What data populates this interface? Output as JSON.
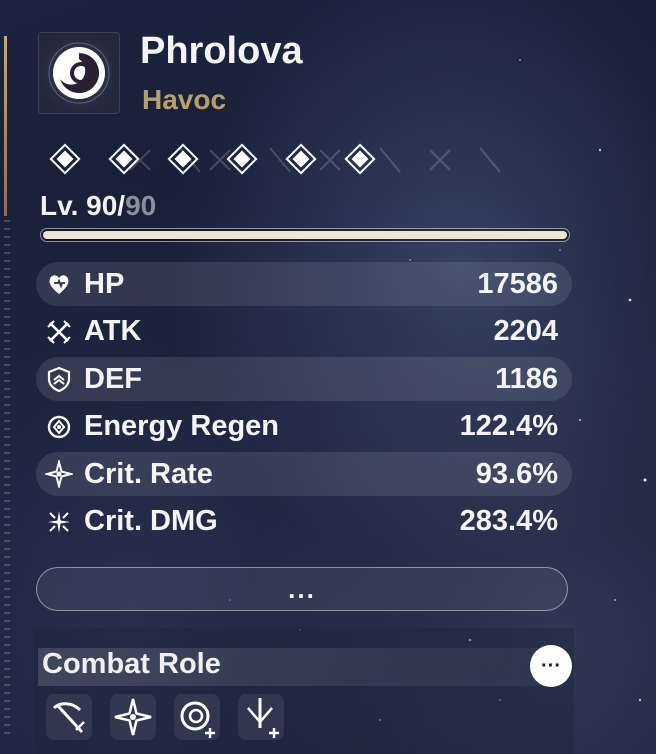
{
  "character": {
    "name": "Phrolova",
    "element": "Havoc",
    "rank_count": 6,
    "portrait_icon": "havoc-swirl-icon"
  },
  "level": {
    "current": "Lv. 90/",
    "max": "90",
    "progress": 1.0
  },
  "stats": [
    {
      "icon": "hp-icon",
      "label": "HP",
      "value": "17586"
    },
    {
      "icon": "atk-icon",
      "label": "ATK",
      "value": "2204"
    },
    {
      "icon": "def-icon",
      "label": "DEF",
      "value": "1186"
    },
    {
      "icon": "energy-regen-icon",
      "label": "Energy Regen",
      "value": "122.4%"
    },
    {
      "icon": "crit-rate-icon",
      "label": "Crit. Rate",
      "value": "93.6%"
    },
    {
      "icon": "crit-dmg-icon",
      "label": "Crit. DMG",
      "value": "283.4%"
    }
  ],
  "more_button": "...",
  "combat_role": {
    "title": "Combat Role",
    "more": "···",
    "icons": [
      "broken-sword-icon",
      "star-burst-icon",
      "havoc-boost-icon",
      "sword-boost-icon"
    ]
  },
  "colors": {
    "element": "#b8a06c",
    "accent_bar": "#c9a57a",
    "level_fill": "#ece6d2"
  }
}
